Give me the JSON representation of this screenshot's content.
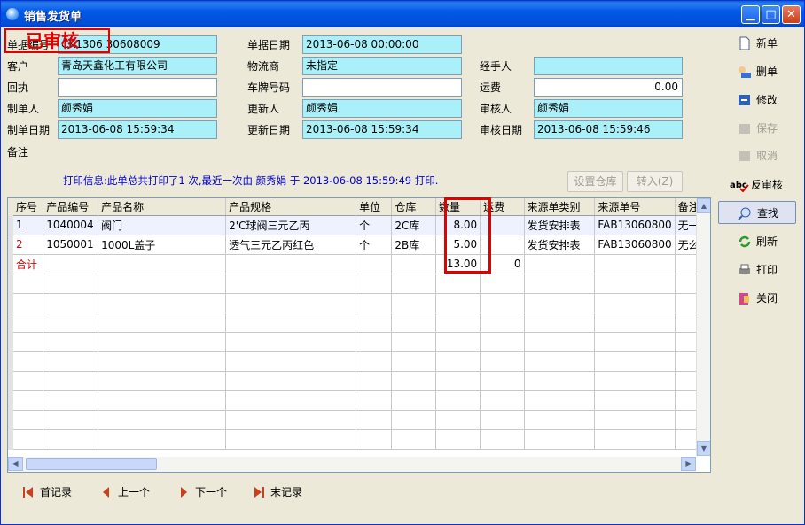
{
  "window": {
    "title": "销售发货单"
  },
  "stamp": "已审核",
  "form": {
    "doc_no_label": "单据编号",
    "doc_no": "CK1306 30608009",
    "doc_date_label": "单据日期",
    "doc_date": "2013-06-08 00:00:00",
    "customer_label": "客户",
    "customer": "青岛天鑫化工有限公司",
    "logistics_label": "物流商",
    "logistics": "未指定",
    "handler_label": "经手人",
    "handler": "",
    "receipt_label": "回执",
    "receipt": "",
    "plate_label": "车牌号码",
    "plate": "",
    "freight_label": "运费",
    "freight": "0.00",
    "creator_label": "制单人",
    "creator": "颜秀娟",
    "updater_label": "更新人",
    "updater": "颜秀娟",
    "auditor_label": "审核人",
    "auditor": "颜秀娟",
    "create_date_label": "制单日期",
    "create_date": "2013-06-08 15:59:34",
    "update_date_label": "更新日期",
    "update_date": "2013-06-08 15:59:34",
    "audit_date_label": "审核日期",
    "audit_date": "2013-06-08 15:59:46",
    "remark_label": "备注"
  },
  "print_info": "打印信息:此单总共打印了1 次,最近一次由 颜秀娟 于 2013-06-08 15:59:49  打印.",
  "buttons": {
    "set_warehouse": "设置仓库",
    "transfer": "转入(Z)"
  },
  "sidebar": {
    "new": "新单",
    "delete": "删单",
    "edit": "修改",
    "save": "保存",
    "cancel": "取消",
    "unaudit": "反审核",
    "find": "查找",
    "refresh": "刷新",
    "print": "打印",
    "close": "关闭"
  },
  "table": {
    "headers": [
      "序号",
      "产品编号",
      "产品名称",
      "产品规格",
      "单位",
      "仓库",
      "数量",
      "运费",
      "来源单类别",
      "来源单号",
      "备注"
    ],
    "rows": [
      [
        "1",
        "1040004",
        "阀门",
        "2'C球阀三元乙丙",
        "个",
        "2C库",
        "8.00",
        "",
        "发货安排表",
        "FAB13060800",
        "无一"
      ],
      [
        "2",
        "1050001",
        "1000L盖子",
        "透气三元乙丙红色",
        "个",
        "2B库",
        "5.00",
        "",
        "发货安排表",
        "FAB13060800",
        "无么"
      ]
    ],
    "total_label": "合计",
    "total_qty": "13.00",
    "total_freight": "0"
  },
  "nav": {
    "first": "首记录",
    "prev": "上一个",
    "next": "下一个",
    "last": "末记录"
  }
}
